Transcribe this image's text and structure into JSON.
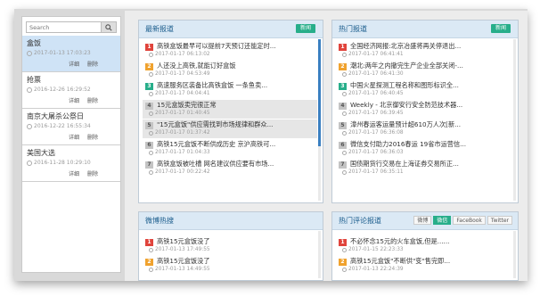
{
  "sidebar": {
    "search_placeholder": "Search",
    "search_icon": "magnifier-icon",
    "items": [
      {
        "title": "盒饭",
        "time": "2017-01-13 17:03:23",
        "detail": "详细",
        "delete": "删除"
      },
      {
        "title": "抢票",
        "time": "2016-12-26 16:29:52",
        "detail": "详细",
        "delete": "删除"
      },
      {
        "title": "南京大屠杀公祭日",
        "time": "2016-12-22 16:55:34",
        "detail": "详细",
        "delete": "删除"
      },
      {
        "title": "美国大选",
        "time": "2016-11-28 10:29:10",
        "detail": "详细",
        "delete": "删除"
      }
    ]
  },
  "panels": {
    "latest": {
      "title": "最新报道",
      "more": "新闻",
      "rows": [
        {
          "num": "1",
          "title": "高铁盒饭最早可以提前7天预订还能定时...",
          "time": "2017-01-17 06:13:02"
        },
        {
          "num": "2",
          "title": "人还没上高铁,就能订好盒饭",
          "time": "2017-01-17 04:53:49"
        },
        {
          "num": "3",
          "title": "高速服务区装备比高铁盒饭 一条鱼卖...",
          "time": "2017-01-17 04:04:41"
        },
        {
          "num": "4",
          "title": "15元盒饭卖完很正常",
          "time": "2017-01-17 01:40:45"
        },
        {
          "num": "5",
          "title": "\"15元盒饭\"供应需找到市场规律和群众...",
          "time": "2017-01-17 01:37:42"
        },
        {
          "num": "6",
          "title": "高铁15元盒饭不断供成历史 京沪高铁可...",
          "time": "2017-01-17 01:04:33"
        },
        {
          "num": "7",
          "title": "高铁盒饭被吐槽 网名建议供应要有市场...",
          "time": "2017-01-17 00:22:42"
        }
      ]
    },
    "hot": {
      "title": "热门报道",
      "more": "新闻",
      "rows": [
        {
          "num": "1",
          "title": "全国经济网报:北京冶盛将再关停退出...",
          "time": "2017-01-17 06:41:41"
        },
        {
          "num": "2",
          "title": "潮北:两年之内撤完生产企业全部关闭-...",
          "time": "2017-01-17 06:41:30"
        },
        {
          "num": "3",
          "title": "中国火星探测工程名称和图形标识全...",
          "time": "2017-01-17 06:40:45"
        },
        {
          "num": "4",
          "title": "Weekly - 北京御安行安全防范技术器...",
          "time": "2017-01-17 06:39:45"
        },
        {
          "num": "5",
          "title": "漳州春运客运量预计超610万人次[新...",
          "time": "2017-01-17 06:36:08"
        },
        {
          "num": "6",
          "title": "微信支付助力2016春运 19省市运营信...",
          "time": "2017-01-17 06:36:03"
        },
        {
          "num": "7",
          "title": "国债期货行交易在上海证券交易所正...",
          "time": "2017-01-17 06:35:11"
        }
      ]
    },
    "weibo": {
      "title": "微博热搜",
      "rows": [
        {
          "num": "1",
          "title": "高铁15元盒饭没了",
          "time": "2017-01-13 17:49:55"
        },
        {
          "num": "2",
          "title": "高铁15元盒饭没了",
          "time": "2017-01-13 14:49:55"
        }
      ]
    },
    "comments": {
      "title": "热门评论报道",
      "tabs": [
        "微博",
        "微信",
        "FaceBook",
        "Twitter"
      ],
      "active_tab": "微信",
      "rows": [
        {
          "num": "1",
          "title": "不必怀念15元的火车盒饭,但是......",
          "time": "2017-01-15 22:23:33"
        },
        {
          "num": "2",
          "title": "高铁15元盒饭\"不断供\"变\"售完即...",
          "time": "2017-01-13 22:24:39"
        }
      ]
    }
  }
}
